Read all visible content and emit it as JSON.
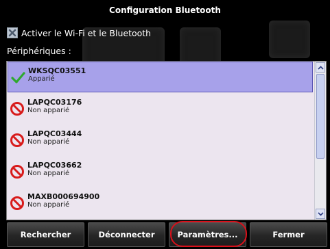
{
  "window": {
    "title": "Configuration Bluetooth"
  },
  "wifi_bt": {
    "label": "Activer le Wi-Fi et le Bluetooth",
    "checked": true
  },
  "devices_label": "Périphériques :",
  "devices": [
    {
      "name": "WKSQC03551",
      "status": "Apparié",
      "paired": true,
      "selected": true
    },
    {
      "name": "LAPQC03176",
      "status": "Non apparié",
      "paired": false,
      "selected": false
    },
    {
      "name": "LAPQC03444",
      "status": "Non apparié",
      "paired": false,
      "selected": false
    },
    {
      "name": "LAPQC03662",
      "status": "Non apparié",
      "paired": false,
      "selected": false
    },
    {
      "name": "MAXB000694900",
      "status": "Non apparié",
      "paired": false,
      "selected": false
    }
  ],
  "buttons": {
    "search": "Rechercher",
    "disconnect": "Déconnecter",
    "settings": "Paramètres...",
    "close": "Fermer"
  },
  "colors": {
    "selected_row": "#a7a1ea",
    "list_bg": "#ece5ef",
    "paired_icon": "#2fa82f",
    "unpaired_icon": "#d81b1b",
    "annotation_ring": "#d9101a"
  },
  "icons": {
    "paired": "check-mark-icon",
    "unpaired": "no-entry-icon",
    "checkbox": "x-mark-icon"
  }
}
